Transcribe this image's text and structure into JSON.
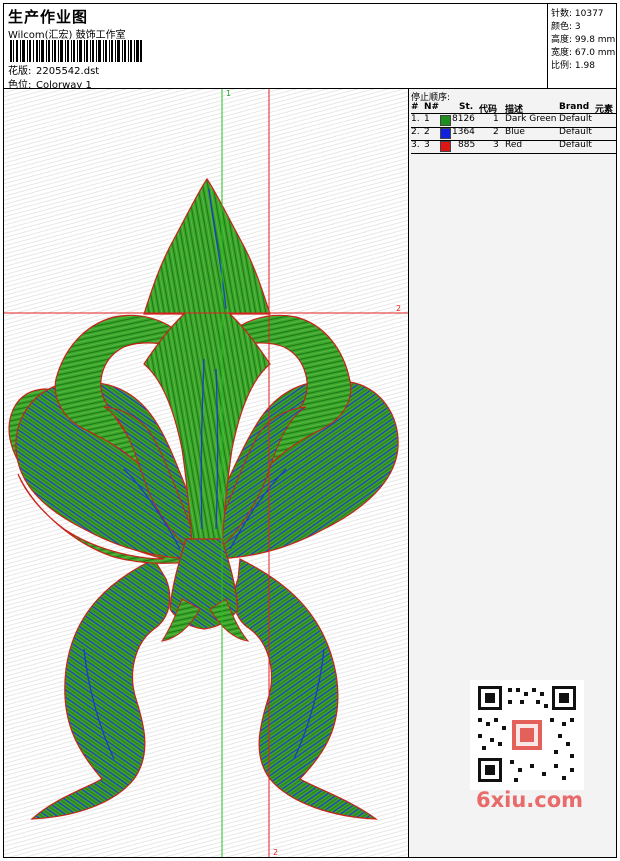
{
  "header": {
    "title": "生产作业图",
    "company": "Wilcom(汇宏) 鼓饰工作室",
    "design_label": "花版:",
    "design_value": "2205542.dst",
    "color_label": "色位:",
    "color_value": "Colorway 1"
  },
  "specs": {
    "stitches": "针数: 10377",
    "colors": "颜色: 3",
    "height": "高度: 99.8 mm",
    "width": "宽度: 67.0 mm",
    "ratio": "比例: 1.98"
  },
  "canvas": {
    "guide_v_green": "1",
    "guide_h_red": "2",
    "guide_v_red": "2"
  },
  "stop_sequence": {
    "title": "停止顺序:",
    "headers": [
      "#",
      "N#",
      "St.",
      "代码",
      "描述",
      "Brand",
      "元素"
    ],
    "rows": [
      {
        "num": "1.",
        "n": "1",
        "color": "#1e8f1e",
        "stitches": "8126",
        "code": "1",
        "desc": "Dark Green",
        "brand": "Default"
      },
      {
        "num": "2.",
        "n": "2",
        "color": "#1020dd",
        "stitches": "1364",
        "code": "2",
        "desc": "Blue",
        "brand": "Default"
      },
      {
        "num": "3.",
        "n": "3",
        "color": "#dd1515",
        "stitches": "885",
        "code": "3",
        "desc": "Red",
        "brand": "Default"
      }
    ]
  },
  "watermark": "6xiu.com",
  "colors": {
    "green": "#2e9a24",
    "blue": "#1a35d6",
    "red": "#d21b12"
  }
}
